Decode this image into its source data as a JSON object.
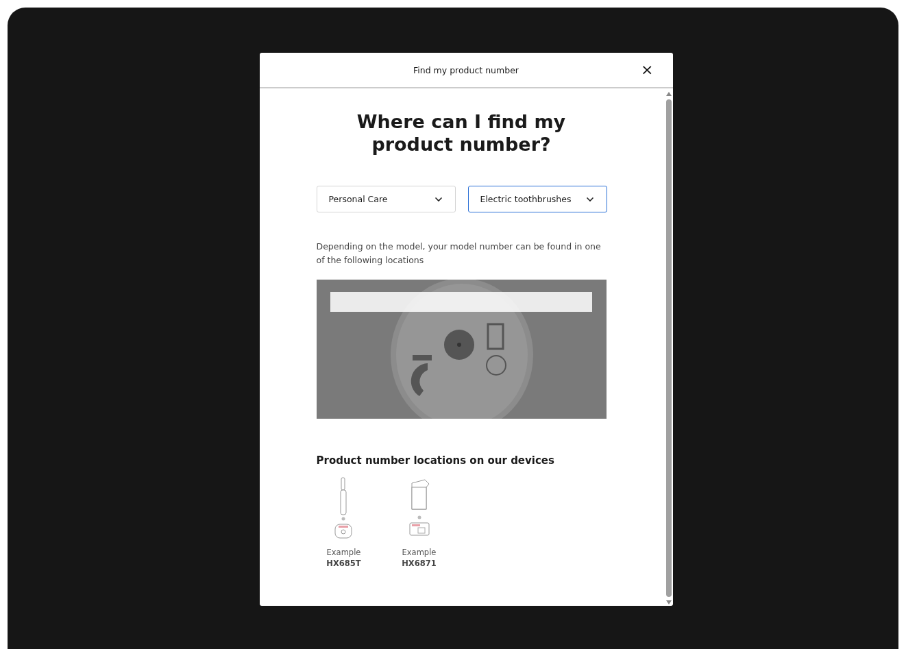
{
  "dialog": {
    "title": "Find my product number",
    "close": "×"
  },
  "heading": "Where can I find my product number?",
  "dropdowns": [
    {
      "value": "Personal Care",
      "focused": false
    },
    {
      "value": "Electric toothbrushes",
      "focused": true
    }
  ],
  "description": "Depending on the model, your model number can be found in one of the following locations",
  "devices_title": "Product number locations on our devices",
  "devices": [
    {
      "kind": "toothbrush",
      "label": "Example",
      "model": "HX685T"
    },
    {
      "kind": "box",
      "label": "Example",
      "model": "HX6871"
    }
  ]
}
